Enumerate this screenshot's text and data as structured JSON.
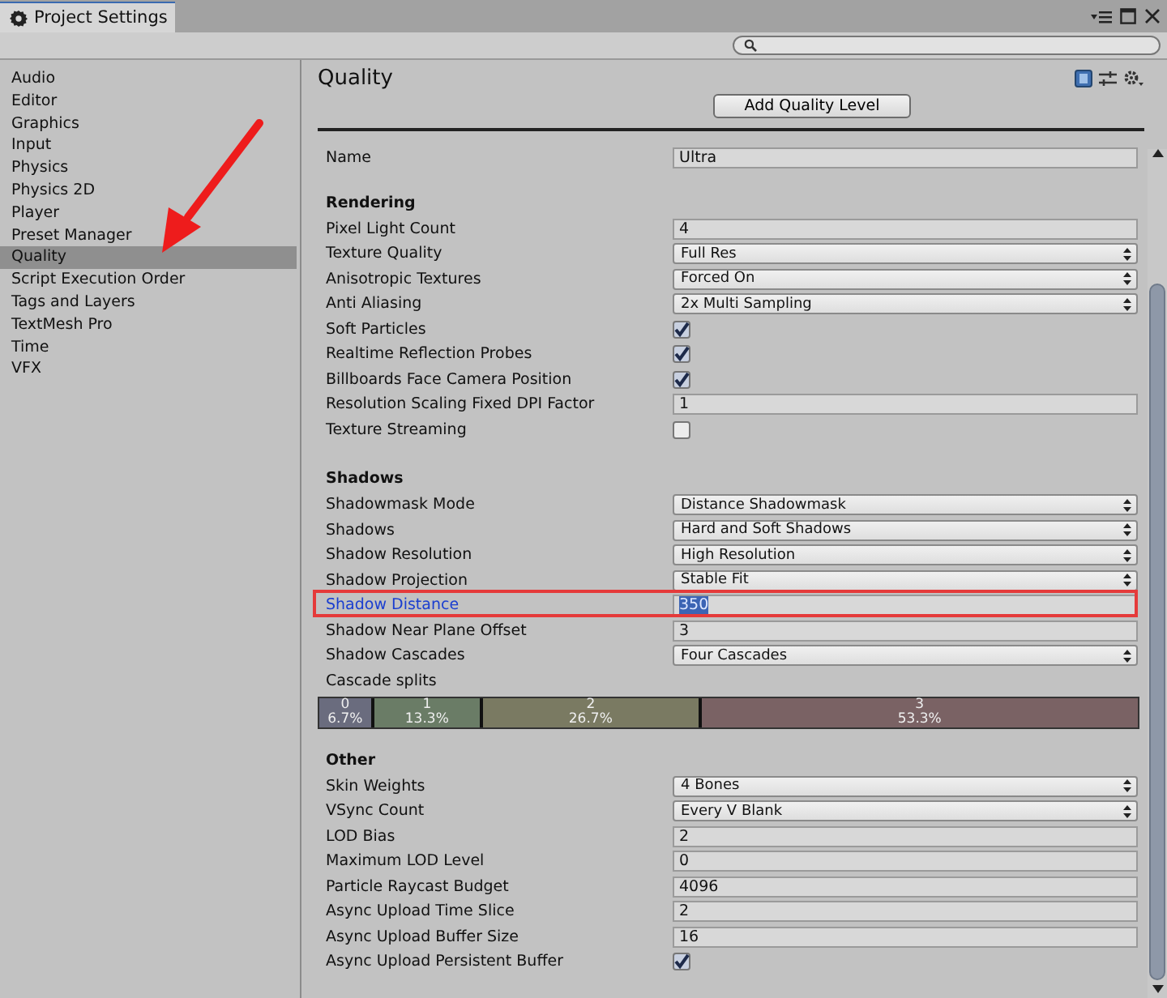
{
  "window": {
    "tab_title": "Project Settings"
  },
  "sidebar": {
    "items": [
      {
        "label": "Audio",
        "selected": false
      },
      {
        "label": "Editor",
        "selected": false
      },
      {
        "label": "Graphics",
        "selected": false
      },
      {
        "label": "Input",
        "selected": false
      },
      {
        "label": "Physics",
        "selected": false
      },
      {
        "label": "Physics 2D",
        "selected": false
      },
      {
        "label": "Player",
        "selected": false
      },
      {
        "label": "Preset Manager",
        "selected": false
      },
      {
        "label": "Quality",
        "selected": true
      },
      {
        "label": "Script Execution Order",
        "selected": false
      },
      {
        "label": "Tags and Layers",
        "selected": false
      },
      {
        "label": "TextMesh Pro",
        "selected": false
      },
      {
        "label": "Time",
        "selected": false
      },
      {
        "label": "VFX",
        "selected": false
      }
    ]
  },
  "panel": {
    "title": "Quality",
    "add_button": "Add Quality Level",
    "name_row": {
      "label": "Name",
      "kind": "text",
      "value": "Ultra"
    },
    "sections": [
      {
        "title": "Rendering",
        "rows": [
          {
            "label": "Pixel Light Count",
            "kind": "text",
            "value": "4"
          },
          {
            "label": "Texture Quality",
            "kind": "dropdown",
            "value": "Full Res"
          },
          {
            "label": "Anisotropic Textures",
            "kind": "dropdown",
            "value": "Forced On"
          },
          {
            "label": "Anti Aliasing",
            "kind": "dropdown",
            "value": "2x Multi Sampling"
          },
          {
            "label": "Soft Particles",
            "kind": "checkbox",
            "checked": true
          },
          {
            "label": "Realtime Reflection Probes",
            "kind": "checkbox",
            "checked": true
          },
          {
            "label": "Billboards Face Camera Position",
            "kind": "checkbox",
            "checked": true
          },
          {
            "label": "Resolution Scaling Fixed DPI Factor",
            "kind": "text",
            "value": "1"
          },
          {
            "label": "Texture Streaming",
            "kind": "checkbox",
            "checked": false
          }
        ]
      },
      {
        "title": "Shadows",
        "rows": [
          {
            "label": "Shadowmask Mode",
            "kind": "dropdown",
            "value": "Distance Shadowmask"
          },
          {
            "label": "Shadows",
            "kind": "dropdown",
            "value": "Hard and Soft Shadows"
          },
          {
            "label": "Shadow Resolution",
            "kind": "dropdown",
            "value": "High Resolution"
          },
          {
            "label": "Shadow Projection",
            "kind": "dropdown",
            "value": "Stable Fit"
          },
          {
            "label": "Shadow Distance",
            "kind": "text",
            "value": "350",
            "focused": true,
            "highlighted": true
          },
          {
            "label": "Shadow Near Plane Offset",
            "kind": "text",
            "value": "3"
          },
          {
            "label": "Shadow Cascades",
            "kind": "dropdown",
            "value": "Four Cascades"
          },
          {
            "label": "Cascade splits",
            "kind": "splits",
            "segments": [
              {
                "index": "0",
                "percent": "6.7%",
                "level": 0.067,
                "color": "#6a6c7e"
              },
              {
                "index": "1",
                "percent": "13.3%",
                "level": 0.133,
                "color": "#6a7c66"
              },
              {
                "index": "2",
                "percent": "26.7%",
                "level": 0.267,
                "color": "#7a7a62"
              },
              {
                "index": "3",
                "percent": "53.3%",
                "level": 0.533,
                "color": "#7a6264"
              }
            ]
          }
        ]
      },
      {
        "title": "Other",
        "rows": [
          {
            "label": "Skin Weights",
            "kind": "dropdown",
            "value": "4 Bones"
          },
          {
            "label": "VSync Count",
            "kind": "dropdown",
            "value": "Every V Blank"
          },
          {
            "label": "LOD Bias",
            "kind": "text",
            "value": "2"
          },
          {
            "label": "Maximum LOD Level",
            "kind": "text",
            "value": "0"
          },
          {
            "label": "Particle Raycast Budget",
            "kind": "text",
            "value": "4096"
          },
          {
            "label": "Async Upload Time Slice",
            "kind": "text",
            "value": "2"
          },
          {
            "label": "Async Upload Buffer Size",
            "kind": "text",
            "value": "16"
          },
          {
            "label": "Async Upload Persistent Buffer",
            "kind": "checkbox",
            "checked": true
          }
        ]
      }
    ]
  },
  "annotations": [
    {
      "kind": "arrow"
    }
  ]
}
